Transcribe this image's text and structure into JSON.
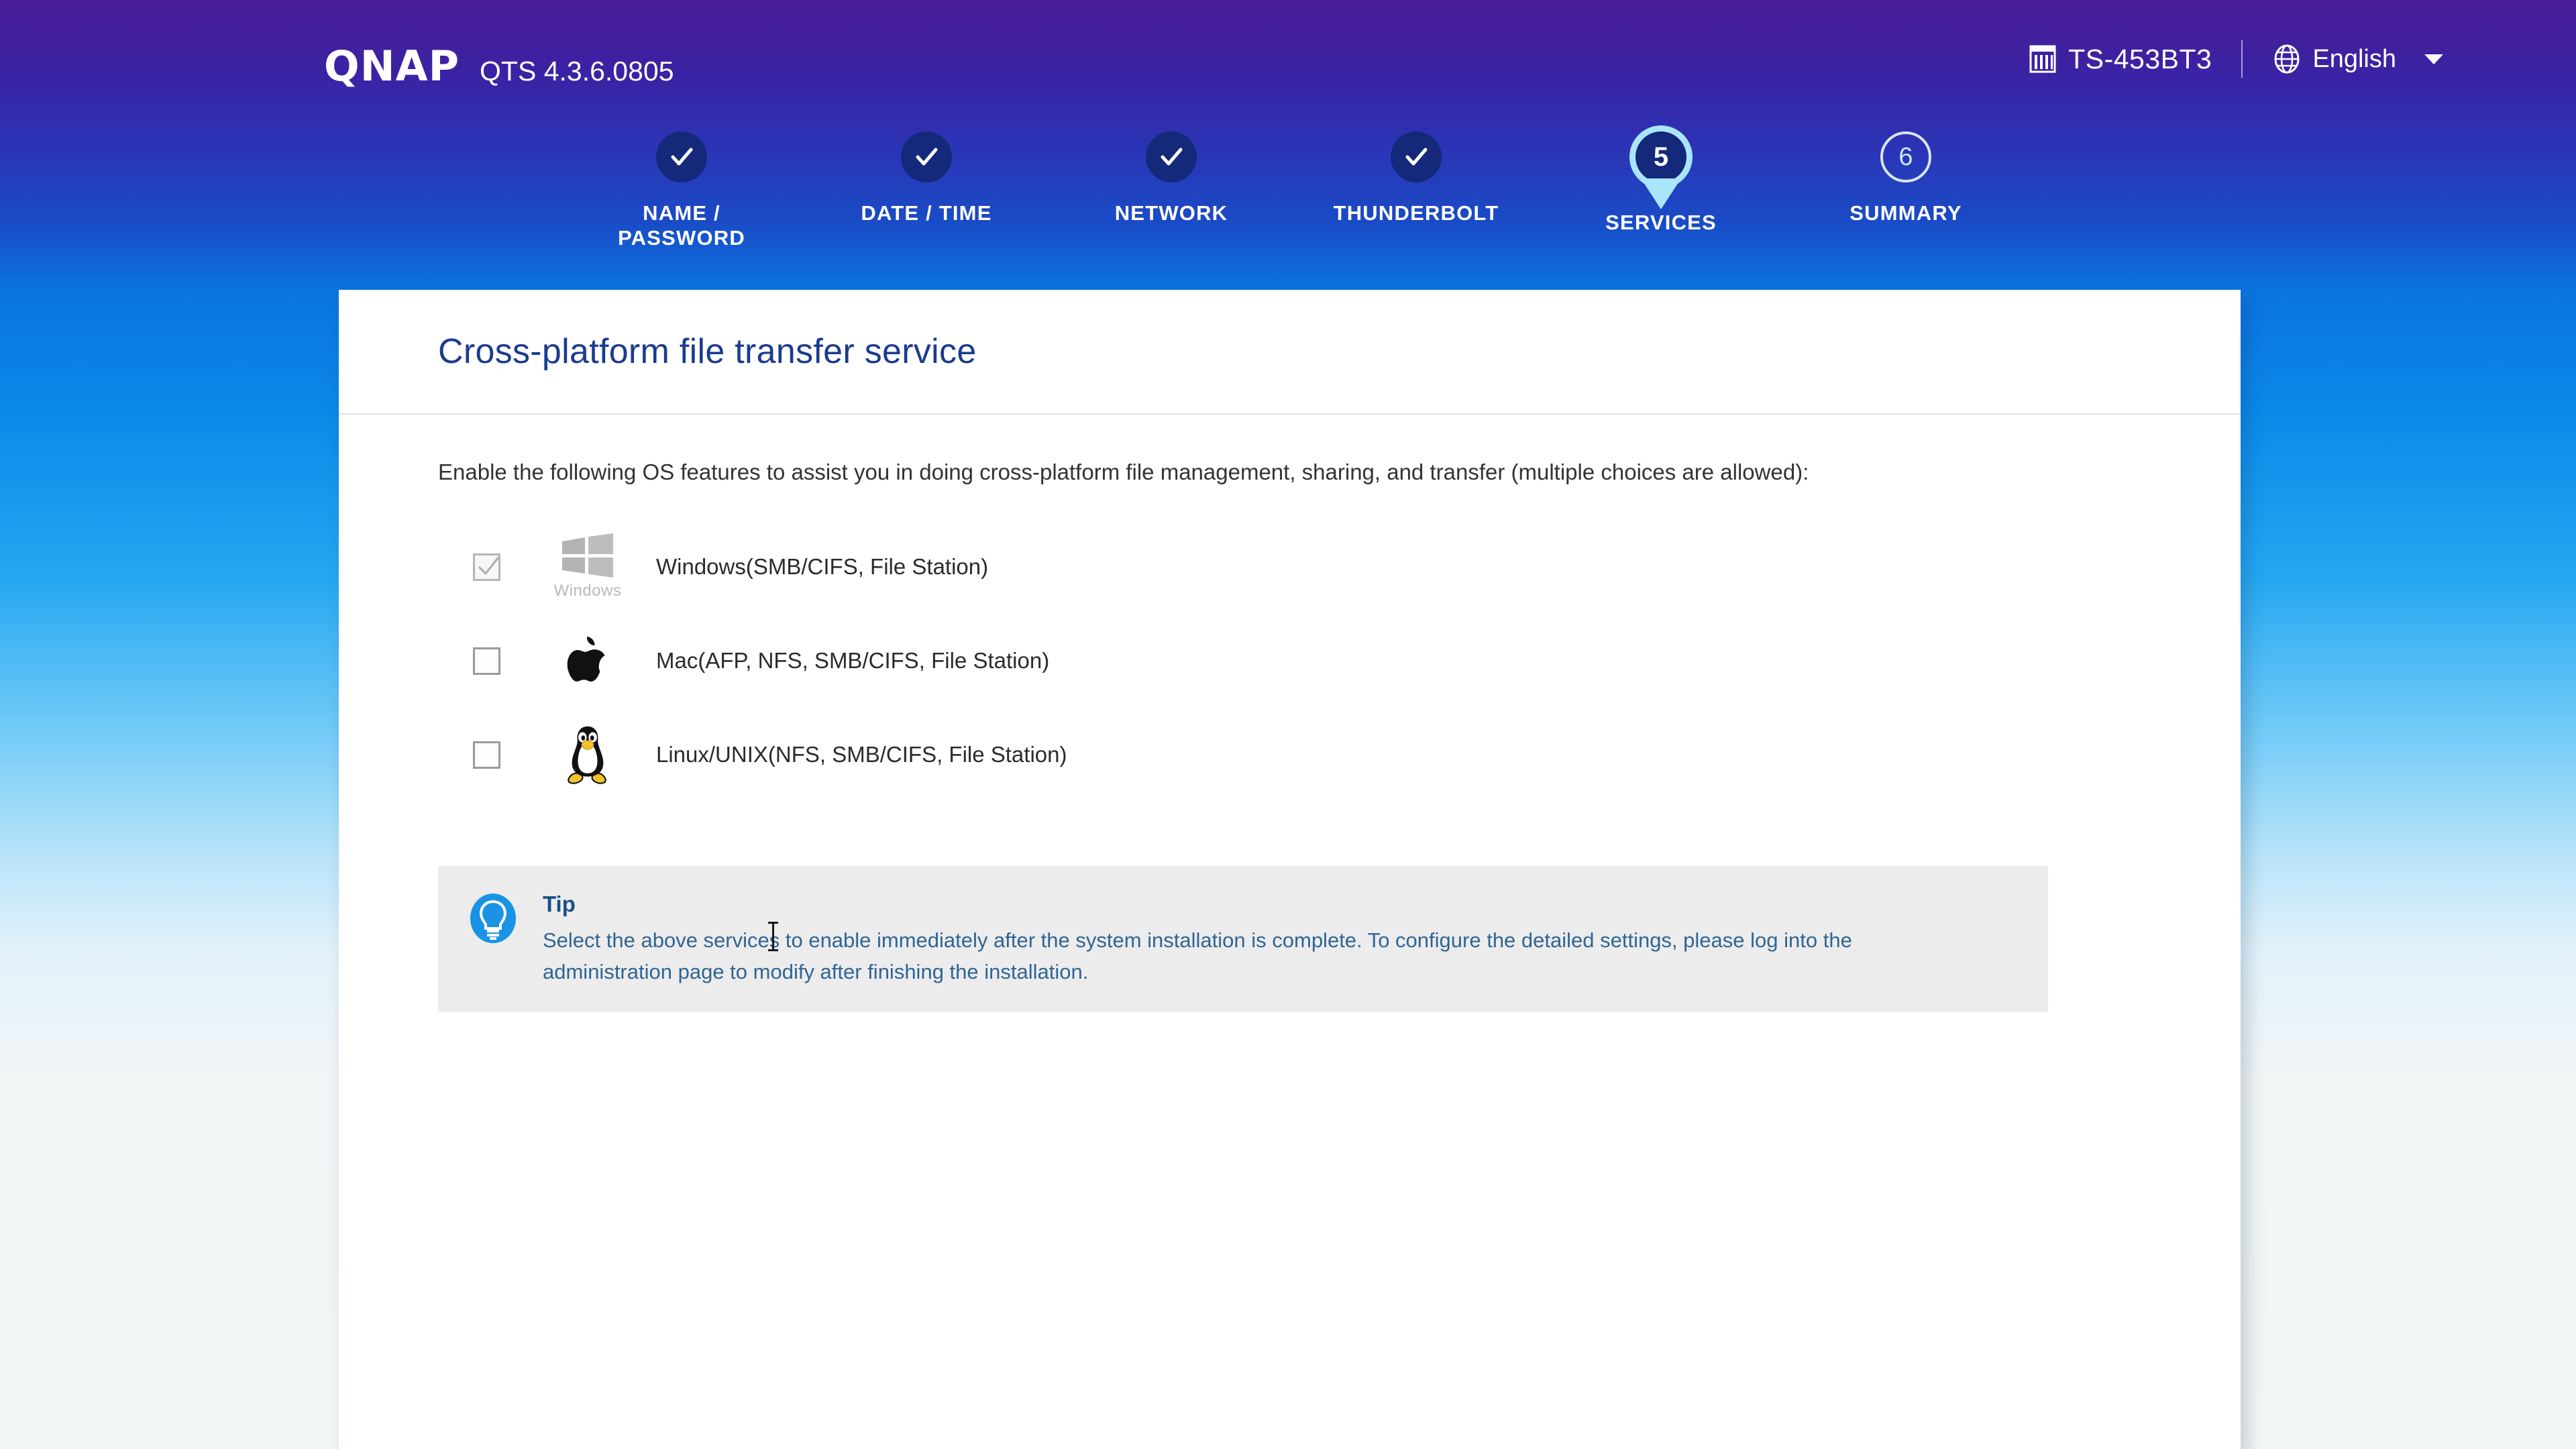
{
  "header": {
    "logo_text": "QNAP",
    "version": "QTS 4.3.6.0805",
    "model": "TS-453BT3",
    "nas_icon": "nas-icon",
    "globe_icon": "globe-icon",
    "language": "English",
    "caret_icon": "chevron-down-icon"
  },
  "stepper": {
    "steps": [
      {
        "index": "1",
        "label": "NAME /\nPASSWORD",
        "state": "done"
      },
      {
        "index": "2",
        "label": "DATE / TIME",
        "state": "done"
      },
      {
        "index": "3",
        "label": "NETWORK",
        "state": "done"
      },
      {
        "index": "4",
        "label": "THUNDERBOLT",
        "state": "done"
      },
      {
        "index": "5",
        "label": "SERVICES",
        "state": "current"
      },
      {
        "index": "6",
        "label": "SUMMARY",
        "state": "todo"
      }
    ],
    "colors": {
      "done_circle": "#14297a",
      "current_ring": "#a9e5fb",
      "todo_border": "#d8e4ee",
      "track_done": "#14297a",
      "track_todo": "#d8e4ee"
    }
  },
  "card": {
    "title": "Cross-platform file transfer service",
    "description": "Enable the following OS features to assist you in doing cross-platform file management, sharing, and transfer (multiple choices are allowed):",
    "os_options": [
      {
        "icon": "windows-logo-icon",
        "icon_caption": "Windows",
        "label": "Windows(SMB/CIFS, File Station)",
        "checked": true,
        "disabled": true
      },
      {
        "icon": "apple-logo-icon",
        "icon_caption": "",
        "label": "Mac(AFP, NFS, SMB/CIFS, File Station)",
        "checked": false,
        "disabled": false
      },
      {
        "icon": "linux-tux-icon",
        "icon_caption": "",
        "label": "Linux/UNIX(NFS, SMB/CIFS, File Station)",
        "checked": false,
        "disabled": false
      }
    ],
    "tip": {
      "icon": "lightbulb-icon",
      "title": "Tip",
      "text": "Select the above services to enable immediately after the system installation is complete. To configure the detailed settings, please log into the administration page to modify after finishing the installation.",
      "background": "#ececec",
      "title_color": "#1b4f86",
      "text_color": "#2f6595"
    }
  },
  "colors": {
    "background_top": "#4a1e97",
    "background_mid": "#0b8ae8",
    "background_bottom": "#f2f6f6",
    "card_background": "#ffffff",
    "title_color": "#1b3b8f"
  }
}
